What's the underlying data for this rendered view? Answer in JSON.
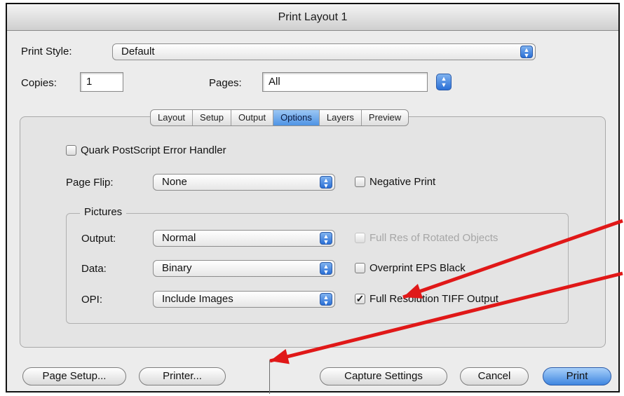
{
  "window": {
    "title": "Print Layout 1"
  },
  "print_style": {
    "label": "Print Style:",
    "value": "Default"
  },
  "copies": {
    "label": "Copies:",
    "value": "1"
  },
  "pages": {
    "label": "Pages:",
    "value": "All"
  },
  "tabs": [
    {
      "label": "Layout",
      "active": false
    },
    {
      "label": "Setup",
      "active": false
    },
    {
      "label": "Output",
      "active": false
    },
    {
      "label": "Options",
      "active": true
    },
    {
      "label": "Layers",
      "active": false
    },
    {
      "label": "Preview",
      "active": false
    }
  ],
  "options": {
    "error_handler": {
      "label": "Quark PostScript Error Handler",
      "checked": false
    },
    "page_flip": {
      "label": "Page Flip:",
      "value": "None"
    },
    "negative_print": {
      "label": "Negative Print",
      "checked": false
    },
    "pictures": {
      "title": "Pictures",
      "output": {
        "label": "Output:",
        "value": "Normal"
      },
      "data": {
        "label": "Data:",
        "value": "Binary"
      },
      "opi": {
        "label": "OPI:",
        "value": "Include Images"
      },
      "full_res_rotated": {
        "label": "Full Res of Rotated Objects",
        "checked": false,
        "disabled": true
      },
      "overprint_eps": {
        "label": "Overprint EPS Black",
        "checked": false
      },
      "full_res_tiff": {
        "label": "Full Resolution TIFF Output",
        "checked": true,
        "mark": "✓"
      }
    }
  },
  "buttons": {
    "page_setup": "Page Setup...",
    "printer": "Printer...",
    "capture_settings": "Capture Settings",
    "cancel": "Cancel",
    "print": "Print"
  },
  "annotation": {
    "arrow_color": "#e01818"
  },
  "theme": {
    "accent": "#2a6fd6"
  }
}
